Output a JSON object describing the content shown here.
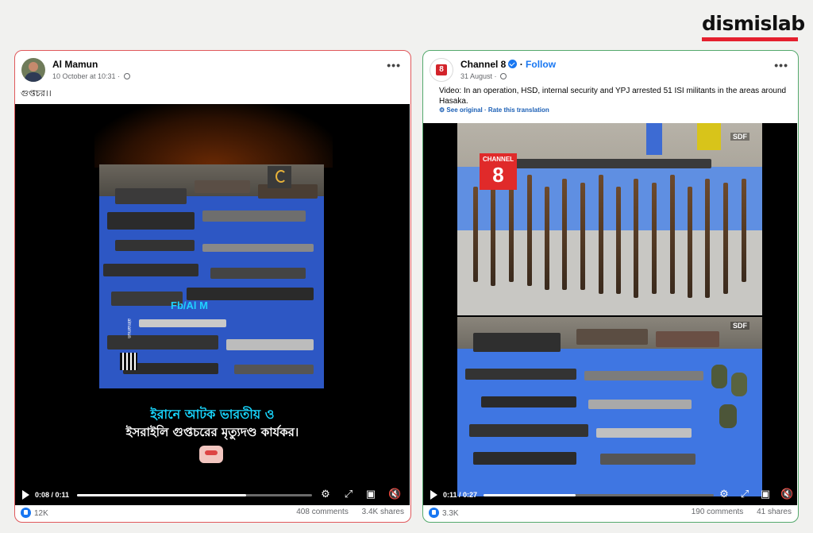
{
  "brand": {
    "logo_text": "dismislab",
    "accent": "#e5202e"
  },
  "left_post": {
    "author": "Al Mamun",
    "timestamp": "10 October at 10:31",
    "caption": "গুপ্তচর।।",
    "video": {
      "watermark_text": "Fb/Al M",
      "side_text": "almamun",
      "headline_line1": "ইরানে আটক ভারতীয় ও",
      "headline_line2": "ইসরাইলি গুপ্তচরের মৃত্যুদণ্ড কার্যকর।",
      "time": "0:08 / 0:11",
      "progress": 0.72
    },
    "likes": "12K",
    "comments": "408 comments",
    "shares": "3.4K shares",
    "border_color": "#e0585b"
  },
  "right_post": {
    "author": "Channel 8",
    "follow_label": "Follow",
    "timestamp": "31 August",
    "caption": "Video: In an operation, HSD, internal security and YPJ arrested 51 ISI militants in the areas around Hasaka.",
    "see_original": "See original",
    "rate_translation": "Rate this translation",
    "video": {
      "logo_top": "CHANNEL",
      "logo_num": "8",
      "sdf_label": "SDF",
      "time": "0:11 / 0:27",
      "progress": 0.4
    },
    "likes": "3.3K",
    "comments": "190 comments",
    "shares": "41 shares",
    "border_color": "#55a96d"
  }
}
